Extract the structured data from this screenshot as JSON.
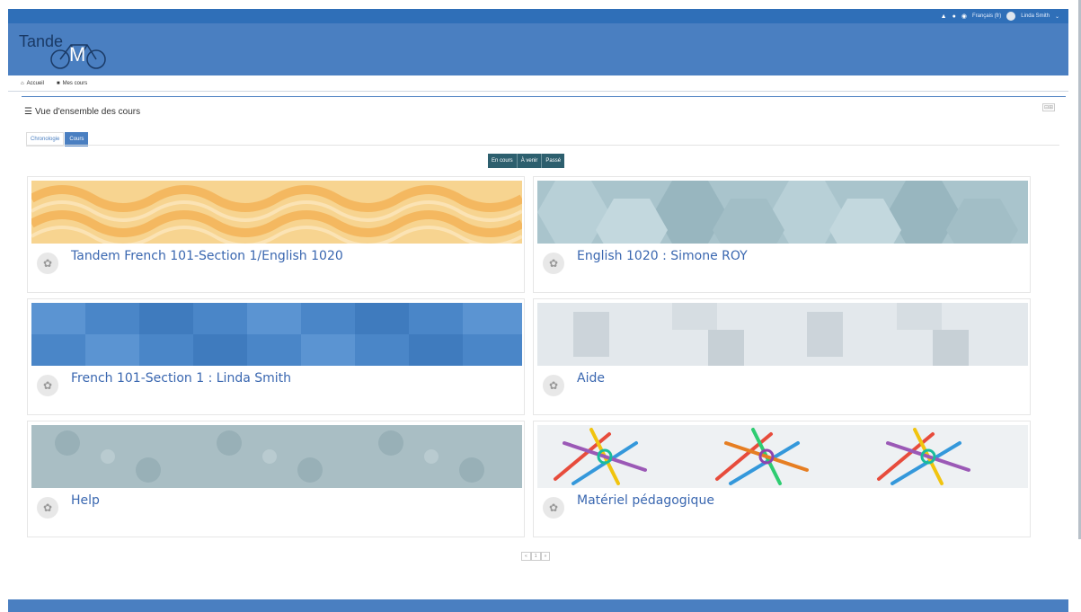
{
  "topbar": {
    "language": "Français (fr)",
    "user": "Linda Smith",
    "bell_icon": "bell-icon",
    "chat_icon": "chat-icon",
    "globe_icon": "globe-icon",
    "dropdown_caret": "⌄"
  },
  "logo": {
    "text_left": "Tande",
    "text_m": "M"
  },
  "nav": {
    "home": "Accueil",
    "my_courses": "Mes cours"
  },
  "block": {
    "title": "Vue d'ensemble des cours",
    "ctl": "⊟⊞"
  },
  "tabs": [
    {
      "label": "Chronologie"
    },
    {
      "label": "Cours"
    }
  ],
  "filters": [
    {
      "label": "En cours"
    },
    {
      "label": "À venir"
    },
    {
      "label": "Passé"
    }
  ],
  "courses": [
    {
      "name": "Tandem French 101-Section 1/English 1020"
    },
    {
      "name": "English 1020 : Simone ROY"
    },
    {
      "name": "French 101-Section 1 : Linda Smith"
    },
    {
      "name": "Aide"
    },
    {
      "name": "Help"
    },
    {
      "name": "Matériel pédagogique"
    }
  ],
  "pager": {
    "prev": "«",
    "current": "1",
    "next": "»"
  },
  "colors": {
    "topbar": "#2f6fb8",
    "header": "#4a7fc1",
    "link": "#3a67b0",
    "filter": "#2d5f6e"
  }
}
